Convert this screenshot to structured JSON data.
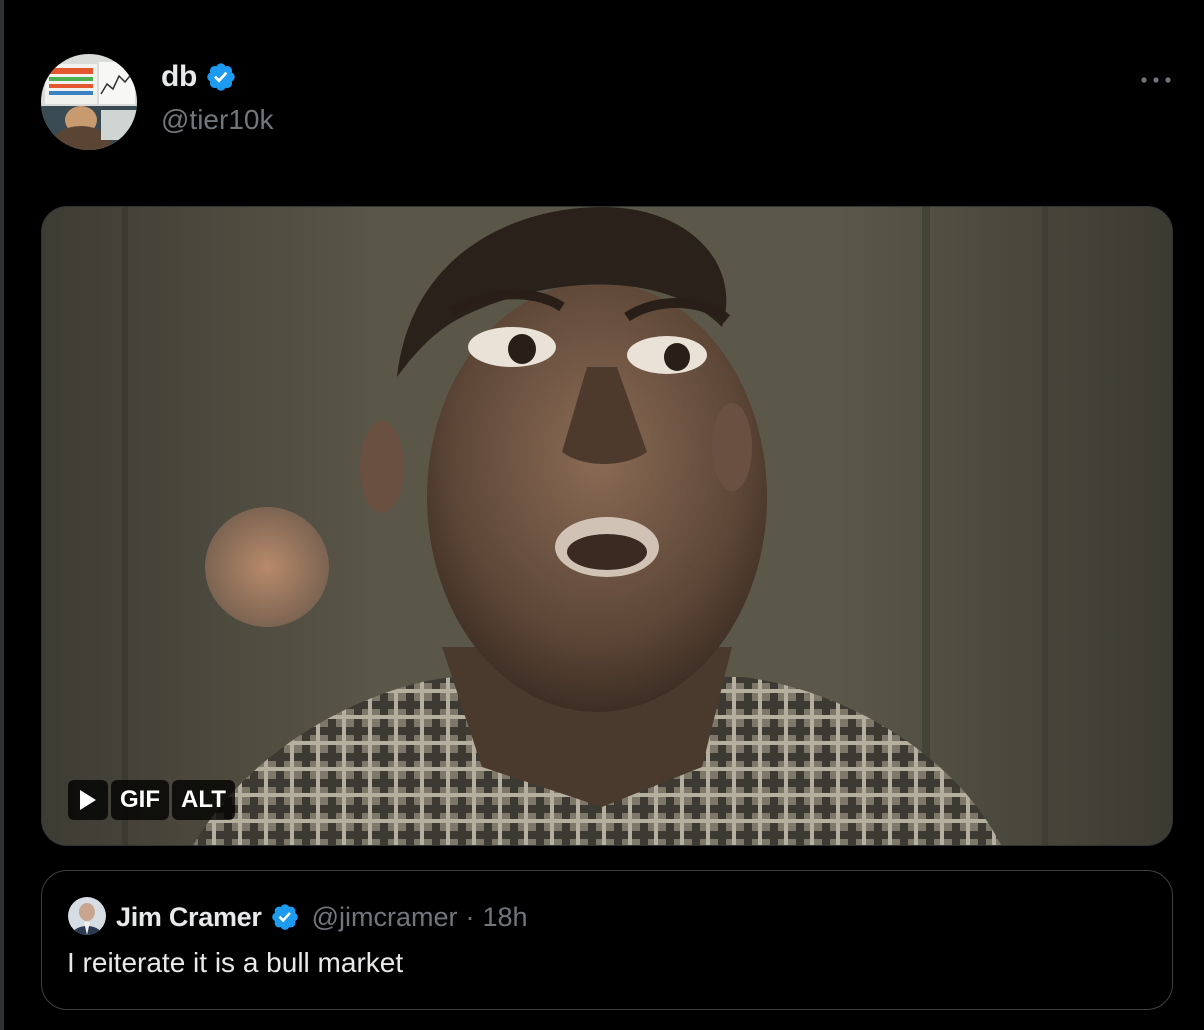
{
  "post": {
    "author": {
      "display_name": "db",
      "handle": "@tier10k",
      "verified": true
    },
    "more_icon": "ellipsis-icon",
    "media": {
      "type": "gif",
      "play_icon": "play-icon",
      "gif_label": "GIF",
      "alt_label": "ALT"
    },
    "quoted": {
      "display_name": "Jim Cramer",
      "handle": "@jimcramer",
      "separator": "·",
      "time": "18h",
      "verified": true,
      "text": "I reiterate it is a bull market"
    }
  },
  "colors": {
    "background": "#000000",
    "primary_text": "#e7e9ea",
    "secondary_text": "#71767b",
    "border": "#2f3336",
    "verified_blue": "#1d9bf0"
  }
}
